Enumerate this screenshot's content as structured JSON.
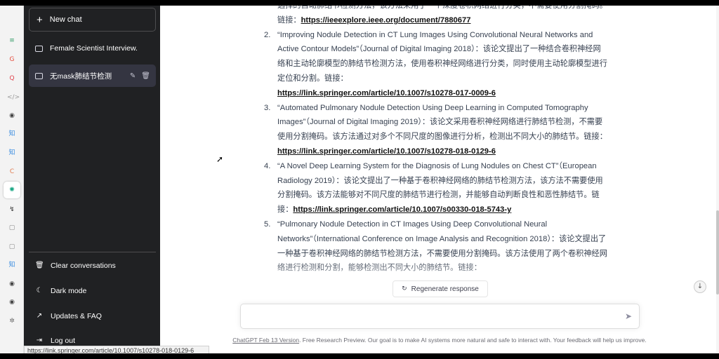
{
  "rail": {
    "icons": [
      {
        "name": "app-icon",
        "glyph": "",
        "color": "#7aa7e8"
      },
      {
        "name": "menu-icon",
        "glyph": "≡",
        "color": "#3a9e6b"
      },
      {
        "name": "google-icon",
        "glyph": "G",
        "color": "#e44b3b"
      },
      {
        "name": "q-icon",
        "glyph": "Q",
        "color": "#e0444e"
      },
      {
        "name": "code-icon",
        "glyph": "</>",
        "color": "#999999"
      },
      {
        "name": "github-icon",
        "glyph": "◉",
        "color": "#444444"
      },
      {
        "name": "zhihu-icon",
        "glyph": "知",
        "color": "#3b8de0"
      },
      {
        "name": "zhihu-icon-2",
        "glyph": "知",
        "color": "#3b8de0"
      },
      {
        "name": "c-icon",
        "glyph": "C",
        "color": "#e07a4e"
      },
      {
        "name": "chatgpt-icon",
        "glyph": "✺",
        "color": "#10a37f"
      },
      {
        "name": "leaf-icon",
        "glyph": "↯",
        "color": "#333333"
      },
      {
        "name": "doc-icon",
        "glyph": "▢",
        "color": "#888888"
      },
      {
        "name": "doc-icon-2",
        "glyph": "▢",
        "color": "#888888"
      },
      {
        "name": "zhihu-icon-3",
        "glyph": "知",
        "color": "#3b8de0"
      },
      {
        "name": "github-icon-2",
        "glyph": "◉",
        "color": "#444444"
      },
      {
        "name": "github-icon-3",
        "glyph": "◉",
        "color": "#444444"
      },
      {
        "name": "settings-icon",
        "glyph": "✲",
        "color": "#666666"
      }
    ]
  },
  "sidebar": {
    "new_chat": "New chat",
    "conversations": [
      "Female Scientist Interview.",
      "无mask肺结节检测"
    ],
    "menu": [
      "Clear conversations",
      "Dark mode",
      "Updates & FAQ",
      "Log out"
    ]
  },
  "status_url": "https://link.springer.com/article/10.1007/s10278-018-0129-6",
  "content": {
    "partial": {
      "text": "选择的自动肺结节检测方法，该方法采用了一个深度卷积网络进行分类，不需要使用分割掩码。链接：",
      "link": "https://ieeexplore.ieee.org/document/7880677"
    },
    "items": [
      {
        "num": "2.",
        "text": "“Improving Nodule Detection in CT Lung Images Using Convolutional Neural Networks and Active Contour Models”（Journal of Digital Imaging 2018）：该论文提出了一种结合卷积神经网络和主动轮廓模型的肺结节检测方法，使用卷积神经网络进行分类，同时使用主动轮廓模型进行定位和分割。链接：",
        "link": "https://link.springer.com/article/10.1007/s10278-017-0009-6"
      },
      {
        "num": "3.",
        "text": "“Automated Pulmonary Nodule Detection Using Deep Learning in Computed Tomography Images”（Journal of Digital Imaging 2019）：该论文采用卷积神经网络进行肺结节检测，不需要使用分割掩码。该方法通过对多个不同尺度的图像进行分析，检测出不同大小的肺结节。链接：",
        "link": "https://link.springer.com/article/10.1007/s10278-018-0129-6"
      },
      {
        "num": "4.",
        "text": "“A Novel Deep Learning System for the Diagnosis of Lung Nodules on Chest CT”（European Radiology 2019）：该论文提出了一种基于卷积神经网络的肺结节检测方法，该方法不需要使用分割掩码。该方法能够对不同尺度的肺结节进行检测，并能够自动判断良性和恶性肺结节。链接：",
        "link": "https://link.springer.com/article/10.1007/s00330-018-5743-y"
      },
      {
        "num": "5.",
        "text": "“Pulmonary Nodule Detection in CT Images Using Deep Convolutional Neural Networks”（International Conference on Image Analysis and Recognition 2018）：该论文提出了一种基于卷积神经网络的肺结节检测方法，不需要使用分割掩码。该方法使用了两个卷积神经网络进行检测和分割，能够检测出不同大小的肺结节。链接：",
        "link": ""
      }
    ]
  },
  "regenerate": "Regenerate response",
  "footer": {
    "version": "ChatGPT Feb 13 Version",
    "text": ". Free Research Preview. Our goal is to make AI systems more natural and safe to interact with. Your feedback will help us improve."
  }
}
